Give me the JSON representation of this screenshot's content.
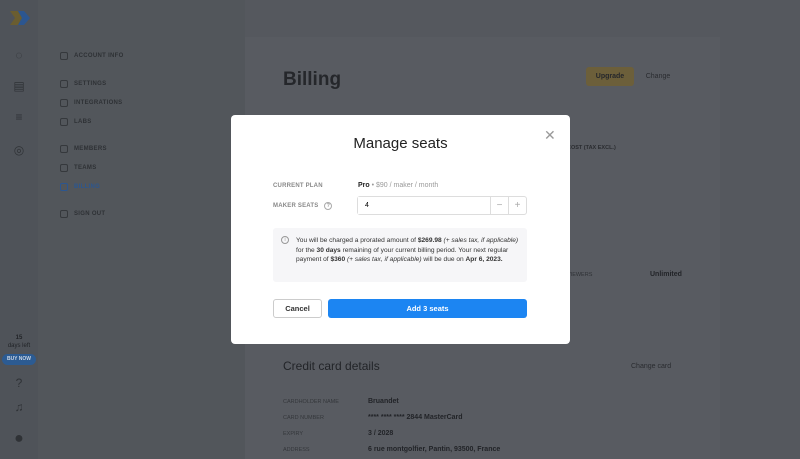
{
  "sidebar": {
    "days_count": "15",
    "days_label": "days left",
    "buy_now": "BUY NOW"
  },
  "settings_nav": [
    {
      "label": "ACCOUNT INFO"
    },
    {
      "label": "SETTINGS"
    },
    {
      "label": "INTEGRATIONS"
    },
    {
      "label": "LABS"
    },
    {
      "label": "MEMBERS"
    },
    {
      "label": "TEAMS"
    },
    {
      "label": "BILLING",
      "active": true
    },
    {
      "label": "SIGN OUT"
    }
  ],
  "billing": {
    "title": "Billing",
    "upgrade": "Upgrade",
    "change": "Change",
    "cost_header": "COST (TAX EXCL.)",
    "viewers_label": "VIEWERS",
    "viewers_value": "Unlimited"
  },
  "credit_card": {
    "title": "Credit card details",
    "change_card": "Change card",
    "rows": [
      {
        "label": "CARDHOLDER NAME",
        "value": "Bruandet"
      },
      {
        "label": "CARD NUMBER",
        "value": "**** **** **** 2844 MasterCard"
      },
      {
        "label": "EXPIRY",
        "value": "3 / 2028"
      },
      {
        "label": "ADDRESS",
        "value": "6 rue montgolfier, Pantin, 93500, France"
      }
    ]
  },
  "modal": {
    "title": "Manage seats",
    "current_plan_label": "CURRENT PLAN",
    "plan_name": "Pro",
    "plan_price": " • $90 / maker / month",
    "maker_seats_label": "MAKER SEATS",
    "seats_value": "4",
    "minus": "−",
    "plus": "+",
    "info": {
      "t1": "You will be charged a prorated amount of ",
      "amount": "$269.98",
      "t2": " (+ sales tax, if applicable)",
      "t3": " for the ",
      "days": "30 days",
      "t4": " remaining of your current billing period. Your next regular payment of ",
      "next": "$360",
      "t5": " (+ sales tax, if applicable)",
      "t6": " will be due on ",
      "date": "Apr 6, 2023."
    },
    "cancel": "Cancel",
    "add": "Add 3 seats"
  },
  "colors": {
    "accent": "#1c85f2",
    "upgrade": "#d8a521"
  }
}
